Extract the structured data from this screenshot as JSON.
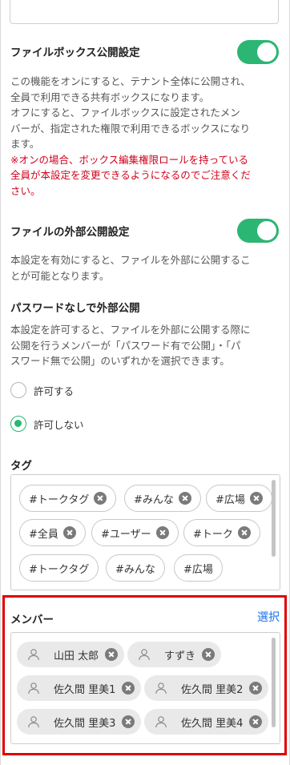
{
  "filebox": {
    "heading": "ファイルボックス公開設定",
    "desc1": "この機能をオンにすると、テナント全体に公開され、",
    "desc2": "全員で利用できる共有ボックスになります。",
    "desc3": "オフにすると、ファイルボックスに設定されたメン",
    "desc4": "バーが、指定された権限で利用できるボックスになり",
    "desc5": "ます。",
    "warn1": "※オンの場合、ボックス編集権限ロールを持っている",
    "warn2": "全員が本設定を変更できるようになるのでご注意くだ",
    "warn3": "さい。",
    "toggle_on": true
  },
  "external": {
    "heading": "ファイルの外部公開設定",
    "desc1": "本設定を有効にすると、ファイルを外部に公開するこ",
    "desc2": "とが可能となります。",
    "toggle_on": true
  },
  "nopassword": {
    "heading": "パスワードなしで外部公開",
    "desc1": "本設定を許可すると、ファイルを外部に公開する際に",
    "desc2": "公開を行うメンバーが「パスワード有で公開」・「パ",
    "desc3": "スワード無で公開」のいずれかを選択できます。",
    "options": [
      "許可する",
      "許可しない"
    ],
    "selected": "許可しない"
  },
  "tags": {
    "label": "タグ",
    "items": [
      "#トークタグ",
      "#みんな",
      "#広場",
      "#全員",
      "#ユーザー",
      "#トーク",
      "#トークタグ",
      "#みんな",
      "#広場"
    ]
  },
  "members": {
    "label": "メンバー",
    "select_label": "選択",
    "items": [
      "山田 太郎",
      "すずき",
      "佐久間 里美1",
      "佐久間 里美2",
      "佐久間 里美3",
      "佐久間 里美4"
    ]
  },
  "colors": {
    "accent": "#2cb673",
    "warning": "#d0021b",
    "link": "#1a73e8",
    "highlight": "#e00000"
  }
}
